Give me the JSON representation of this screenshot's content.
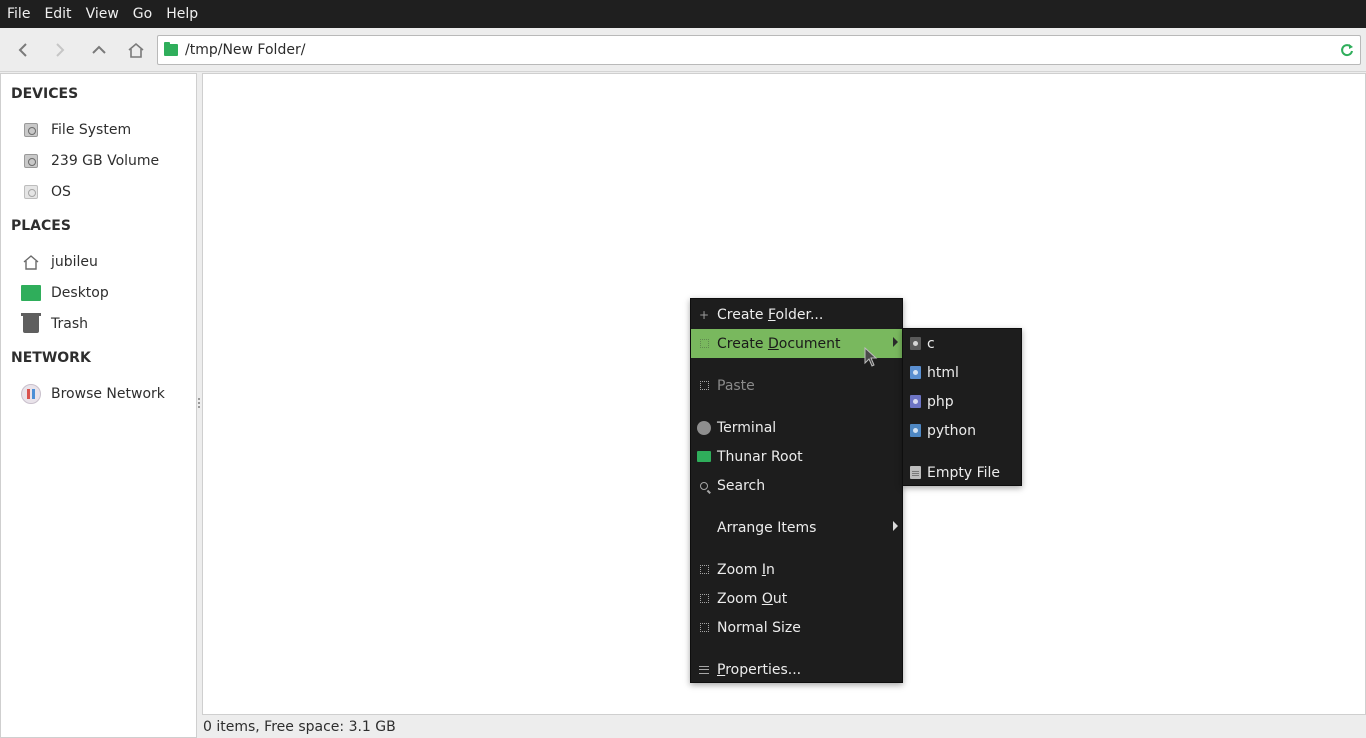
{
  "menubar": {
    "items": [
      "File",
      "Edit",
      "View",
      "Go",
      "Help"
    ]
  },
  "toolbar": {
    "back_icon": "chevron-left-icon",
    "forward_icon": "chevron-right-icon",
    "up_icon": "chevron-up-icon",
    "home_icon": "home-icon",
    "location_path": "/tmp/New Folder/",
    "reload_icon": "reload-icon"
  },
  "sidebar": {
    "devices_heading": "DEVICES",
    "devices": [
      {
        "label": "File System",
        "icon": "drive-icon"
      },
      {
        "label": "239 GB Volume",
        "icon": "drive-icon"
      },
      {
        "label": "OS",
        "icon": "drive-icon"
      }
    ],
    "places_heading": "PLACES",
    "places": [
      {
        "label": "jubileu",
        "icon": "home-icon"
      },
      {
        "label": "Desktop",
        "icon": "desktop-folder-icon"
      },
      {
        "label": "Trash",
        "icon": "trash-icon"
      }
    ],
    "network_heading": "NETWORK",
    "network": [
      {
        "label": "Browse Network",
        "icon": "network-icon"
      }
    ]
  },
  "status": {
    "text": "0 items, Free space: 3.1 GB"
  },
  "context_menu": {
    "create_folder": {
      "pre": "Create ",
      "ul": "F",
      "post": "older..."
    },
    "create_document": {
      "pre": "Create ",
      "ul": "D",
      "post": "ocument"
    },
    "paste": "Paste",
    "terminal": "Terminal",
    "thunar_root": "Thunar Root",
    "search": "Search",
    "arrange_items": "Arrange Items",
    "zoom_in": {
      "pre": "Zoom ",
      "ul": "I",
      "post": "n"
    },
    "zoom_out": {
      "pre": "Zoom ",
      "ul": "O",
      "post": "ut"
    },
    "normal_size": "Normal Size",
    "properties": {
      "ul": "P",
      "post": "roperties..."
    }
  },
  "submenu": {
    "items": [
      {
        "label": "c",
        "icon": "c-source-icon"
      },
      {
        "label": "html",
        "icon": "html-file-icon"
      },
      {
        "label": "php",
        "icon": "php-file-icon"
      },
      {
        "label": "python",
        "icon": "python-file-icon"
      },
      {
        "label": "Empty File",
        "icon": "text-file-icon"
      }
    ]
  },
  "colors": {
    "menubar_bg": "#1f1f1f",
    "menu_bg": "#1d1d1d",
    "highlight": "#79b85e",
    "folder_green": "#2fae5b"
  }
}
